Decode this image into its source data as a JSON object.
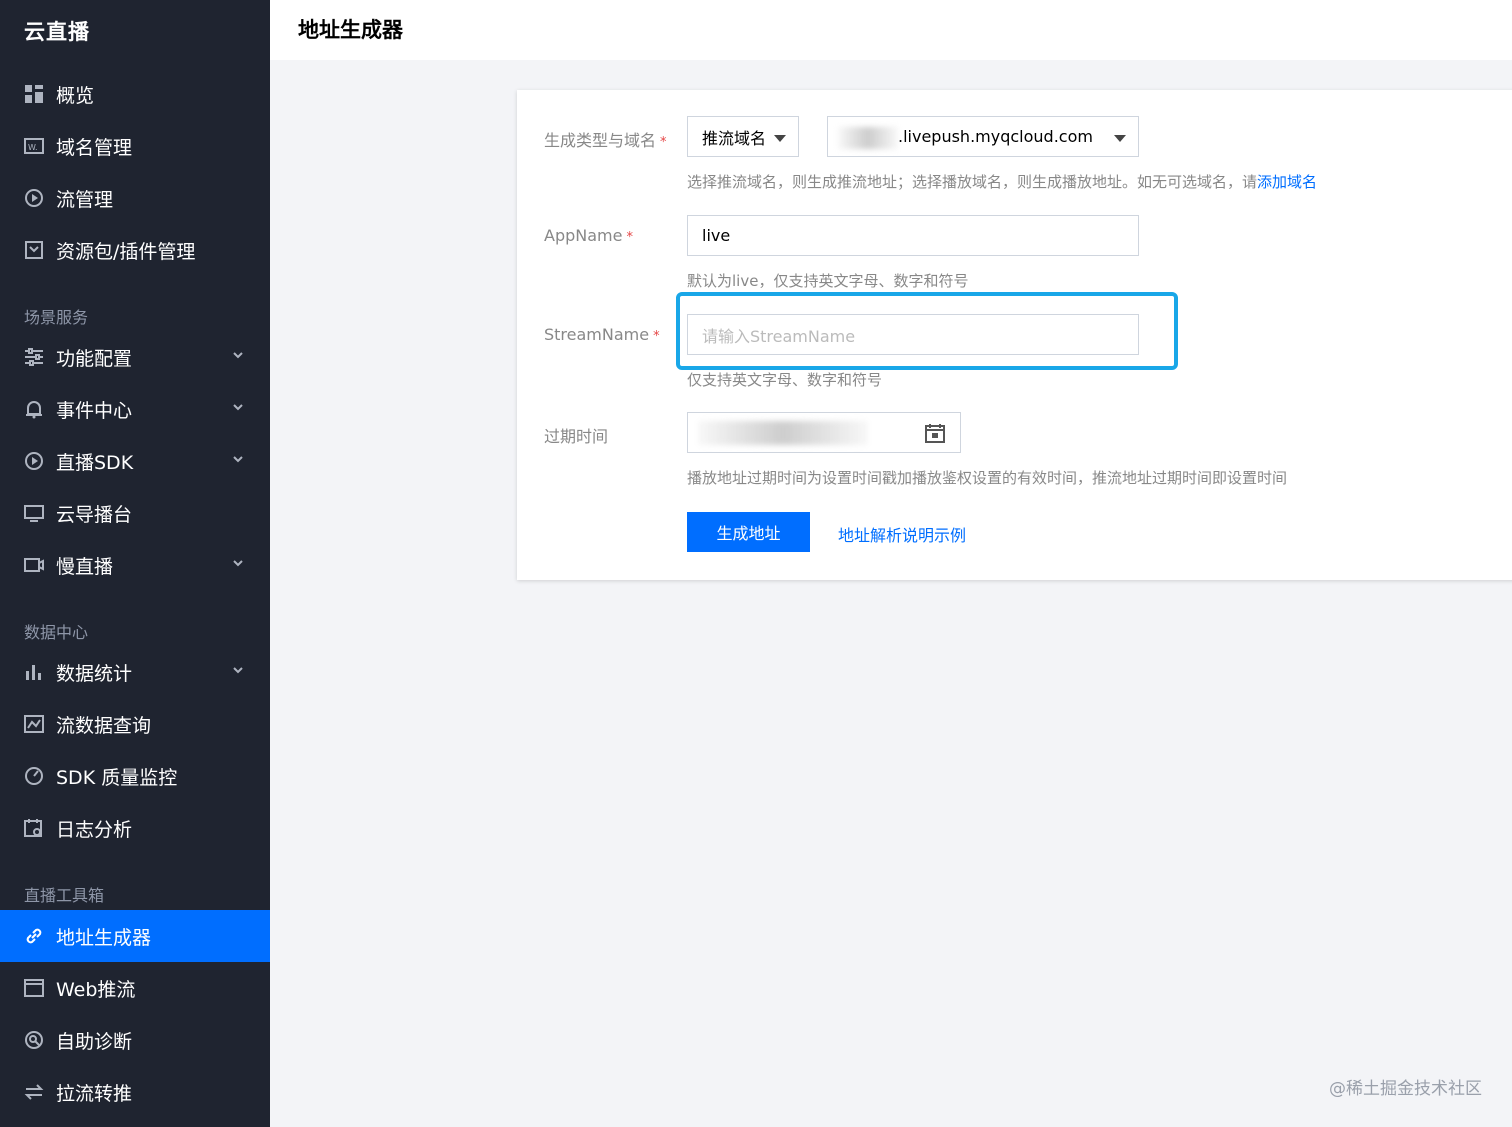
{
  "sidebar": {
    "brand": "云直播",
    "sections": {
      "scene": "场景服务",
      "data": "数据中心",
      "tools": "直播工具箱"
    },
    "items": {
      "overview": "概览",
      "domain": "域名管理",
      "stream": "流管理",
      "package": "资源包/插件管理",
      "feature": "功能配置",
      "event": "事件中心",
      "sdk": "直播SDK",
      "director": "云导播台",
      "slow": "慢直播",
      "stats": "数据统计",
      "streamQuery": "流数据查询",
      "sdkMonitor": "SDK 质量监控",
      "log": "日志分析",
      "addrGen": "地址生成器",
      "webPush": "Web推流",
      "diagnose": "自助诊断",
      "relay": "拉流转推"
    }
  },
  "header": {
    "title": "地址生成器"
  },
  "form": {
    "type_label": "生成类型与域名",
    "required_mark": "*",
    "type_select": "推流域名",
    "domain_select": ".livepush.myqcloud.com",
    "type_hint": "选择推流域名，则生成推流地址；选择播放域名，则生成播放地址。如无可选域名，请",
    "add_domain_link": "添加域名",
    "appname_label": "AppName",
    "appname_value": "live",
    "appname_hint": "默认为live，仅支持英文字母、数字和符号",
    "streamname_label": "StreamName",
    "streamname_placeholder": "请输入StreamName",
    "streamname_hint": "仅支持英文字母、数字和符号",
    "expire_label": "过期时间",
    "expire_hint": "播放地址过期时间为设置时间戳加播放鉴权设置的有效时间，推流地址过期时间即设置时间",
    "generate_button": "生成地址",
    "explain_link": "地址解析说明示例"
  },
  "watermark": "@稀土掘金技术社区",
  "colors": {
    "primary": "#006eff",
    "sidebar": "#1f2430",
    "highlight": "#19a7e8",
    "required": "#e54545"
  }
}
